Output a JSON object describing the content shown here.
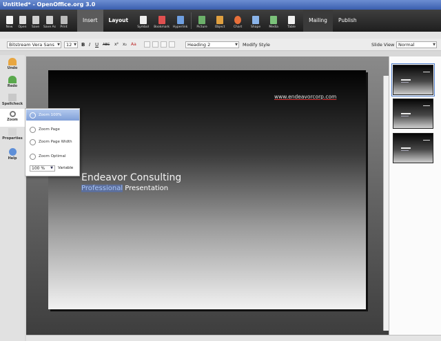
{
  "window": {
    "title": "Untitled* - OpenOffice.org 3.0"
  },
  "ribbon": {
    "file_buttons": [
      {
        "label": "New",
        "icon": "new-doc-icon"
      },
      {
        "label": "Open",
        "icon": "open-folder-icon"
      },
      {
        "label": "Save",
        "icon": "save-icon"
      },
      {
        "label": "Save As",
        "icon": "save-as-icon"
      },
      {
        "label": "Print",
        "icon": "print-icon"
      }
    ],
    "tabs": {
      "insert": "Insert",
      "layout": "Layout",
      "mailing": "Mailing",
      "publish": "Publish"
    },
    "insert_buttons": [
      {
        "label": "Symbol",
        "icon": "symbol-icon"
      },
      {
        "label": "Bookmark",
        "icon": "bookmark-icon"
      },
      {
        "label": "Hyperlink",
        "icon": "hyperlink-icon"
      },
      {
        "label": "Picture",
        "icon": "picture-icon"
      },
      {
        "label": "Object",
        "icon": "object-icon"
      },
      {
        "label": "Chart",
        "icon": "chart-icon"
      },
      {
        "label": "Shape",
        "icon": "shape-icon"
      },
      {
        "label": "Media",
        "icon": "media-icon"
      },
      {
        "label": "Table",
        "icon": "table-icon"
      }
    ]
  },
  "format": {
    "font": "Bitstream Vera Sans",
    "size": "12",
    "bold": "B",
    "italic": "I",
    "underline": "U",
    "strike": "ABC",
    "superscript": "x²",
    "subscript": "x₂",
    "highlight": "Aa",
    "style": "Heading 2",
    "modify_style": "Modify Style",
    "slide_view_label": "Slide View",
    "slide_view_value": "Normal"
  },
  "sidebar": {
    "items": [
      {
        "label": "Undo",
        "icon": "undo-icon"
      },
      {
        "label": "Redo",
        "icon": "redo-icon"
      },
      {
        "label": "Spellcheck",
        "icon": "spellcheck-icon"
      },
      {
        "label": "Zoom",
        "icon": "zoom-icon"
      },
      {
        "label": "Properties",
        "icon": "properties-icon"
      },
      {
        "label": "Help",
        "icon": "help-icon"
      }
    ]
  },
  "zoom_menu": {
    "items": [
      "Zoom 100%",
      "Zoom Page",
      "Zoom Page Width",
      "Zoom Optimal"
    ],
    "value": "100 %",
    "variable": "Variable"
  },
  "slide": {
    "url": "www.endeavorcorp.com",
    "title": "Endeavor Consulting",
    "subtitle_word1": "Professional",
    "subtitle_word2": "Presentation"
  },
  "colors": {
    "accent": "#3a5eae",
    "ribbon": "#2a2a2a",
    "selection": "#7f9fd8"
  }
}
